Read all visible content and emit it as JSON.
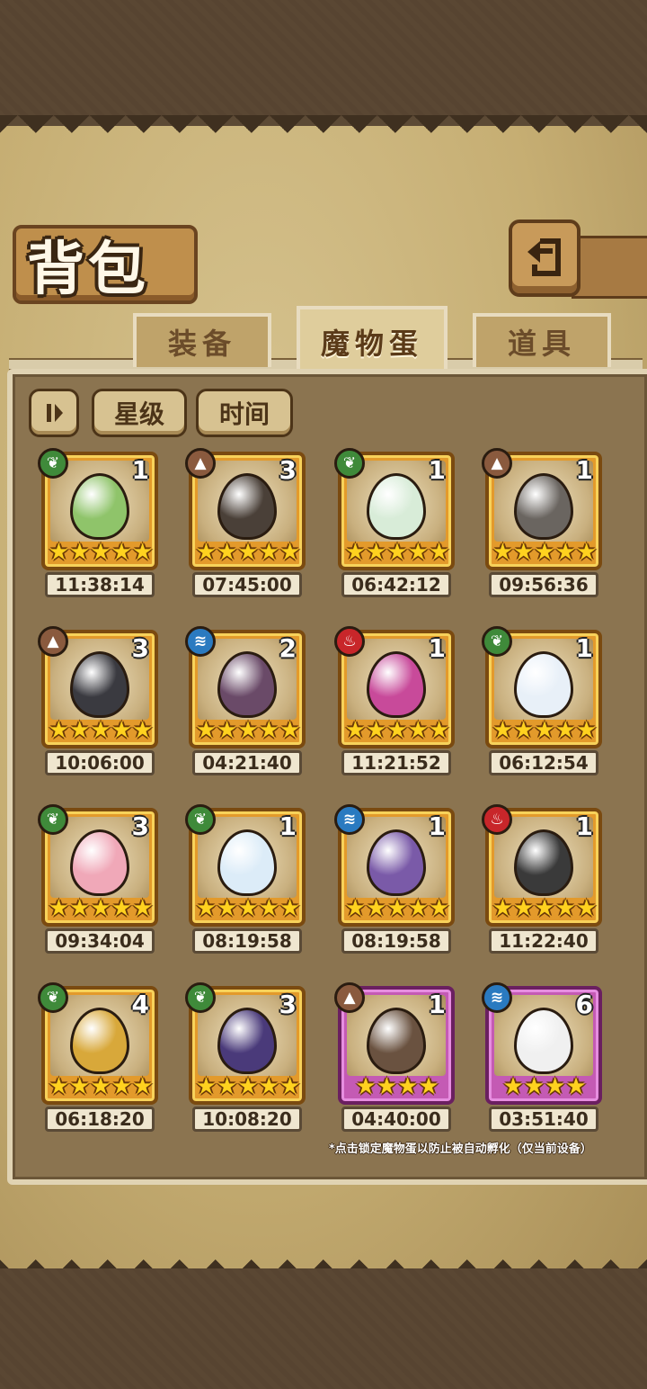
{
  "title": "背包",
  "tabs": [
    {
      "label": "装备",
      "active": false
    },
    {
      "label": "魔物蛋",
      "active": true
    },
    {
      "label": "道具",
      "active": false
    }
  ],
  "sort_buttons": {
    "star": "星级",
    "time": "时间"
  },
  "footer_note": "*点击锁定魔物蛋以防止被自动孵化（仅当前设备）",
  "element_colors": {
    "grass": "#3f8a3a",
    "earth": "#8a5a3e",
    "water": "#2a7ac0",
    "fire": "#c8262a"
  },
  "eggs": [
    {
      "element": "grass",
      "count": "1",
      "stars": 5,
      "timer": "11:38:14",
      "rarity": "gold",
      "color": "#8fc46a"
    },
    {
      "element": "earth",
      "count": "3",
      "stars": 5,
      "timer": "07:45:00",
      "rarity": "gold",
      "color": "#4a4038"
    },
    {
      "element": "grass",
      "count": "1",
      "stars": 5,
      "timer": "06:42:12",
      "rarity": "gold",
      "color": "#d8ecd8"
    },
    {
      "element": "earth",
      "count": "1",
      "stars": 5,
      "timer": "09:56:36",
      "rarity": "gold",
      "color": "#6a6560"
    },
    {
      "element": "earth",
      "count": "3",
      "stars": 5,
      "timer": "10:06:00",
      "rarity": "gold",
      "color": "#3a3a40"
    },
    {
      "element": "water",
      "count": "2",
      "stars": 5,
      "timer": "04:21:40",
      "rarity": "gold",
      "color": "#6a4a68"
    },
    {
      "element": "fire",
      "count": "1",
      "stars": 5,
      "timer": "11:21:52",
      "rarity": "gold",
      "color": "#c84a9a"
    },
    {
      "element": "grass",
      "count": "1",
      "stars": 5,
      "timer": "06:12:54",
      "rarity": "gold",
      "color": "#e8f0f8"
    },
    {
      "element": "grass",
      "count": "3",
      "stars": 5,
      "timer": "09:34:04",
      "rarity": "gold",
      "color": "#f0a8b8"
    },
    {
      "element": "grass",
      "count": "1",
      "stars": 5,
      "timer": "08:19:58",
      "rarity": "gold",
      "color": "#dcecf8"
    },
    {
      "element": "water",
      "count": "1",
      "stars": 5,
      "timer": "08:19:58",
      "rarity": "gold",
      "color": "#7a5aa8"
    },
    {
      "element": "fire",
      "count": "1",
      "stars": 5,
      "timer": "11:22:40",
      "rarity": "gold",
      "color": "#3a3a3a"
    },
    {
      "element": "grass",
      "count": "4",
      "stars": 5,
      "timer": "06:18:20",
      "rarity": "gold",
      "color": "#d8a83a"
    },
    {
      "element": "grass",
      "count": "3",
      "stars": 5,
      "timer": "10:08:20",
      "rarity": "gold",
      "color": "#4a3a7a"
    },
    {
      "element": "earth",
      "count": "1",
      "stars": 4,
      "timer": "04:40:00",
      "rarity": "pink",
      "color": "#6a5240"
    },
    {
      "element": "water",
      "count": "6",
      "stars": 4,
      "timer": "03:51:40",
      "rarity": "pink",
      "color": "#f0f0f0"
    }
  ]
}
